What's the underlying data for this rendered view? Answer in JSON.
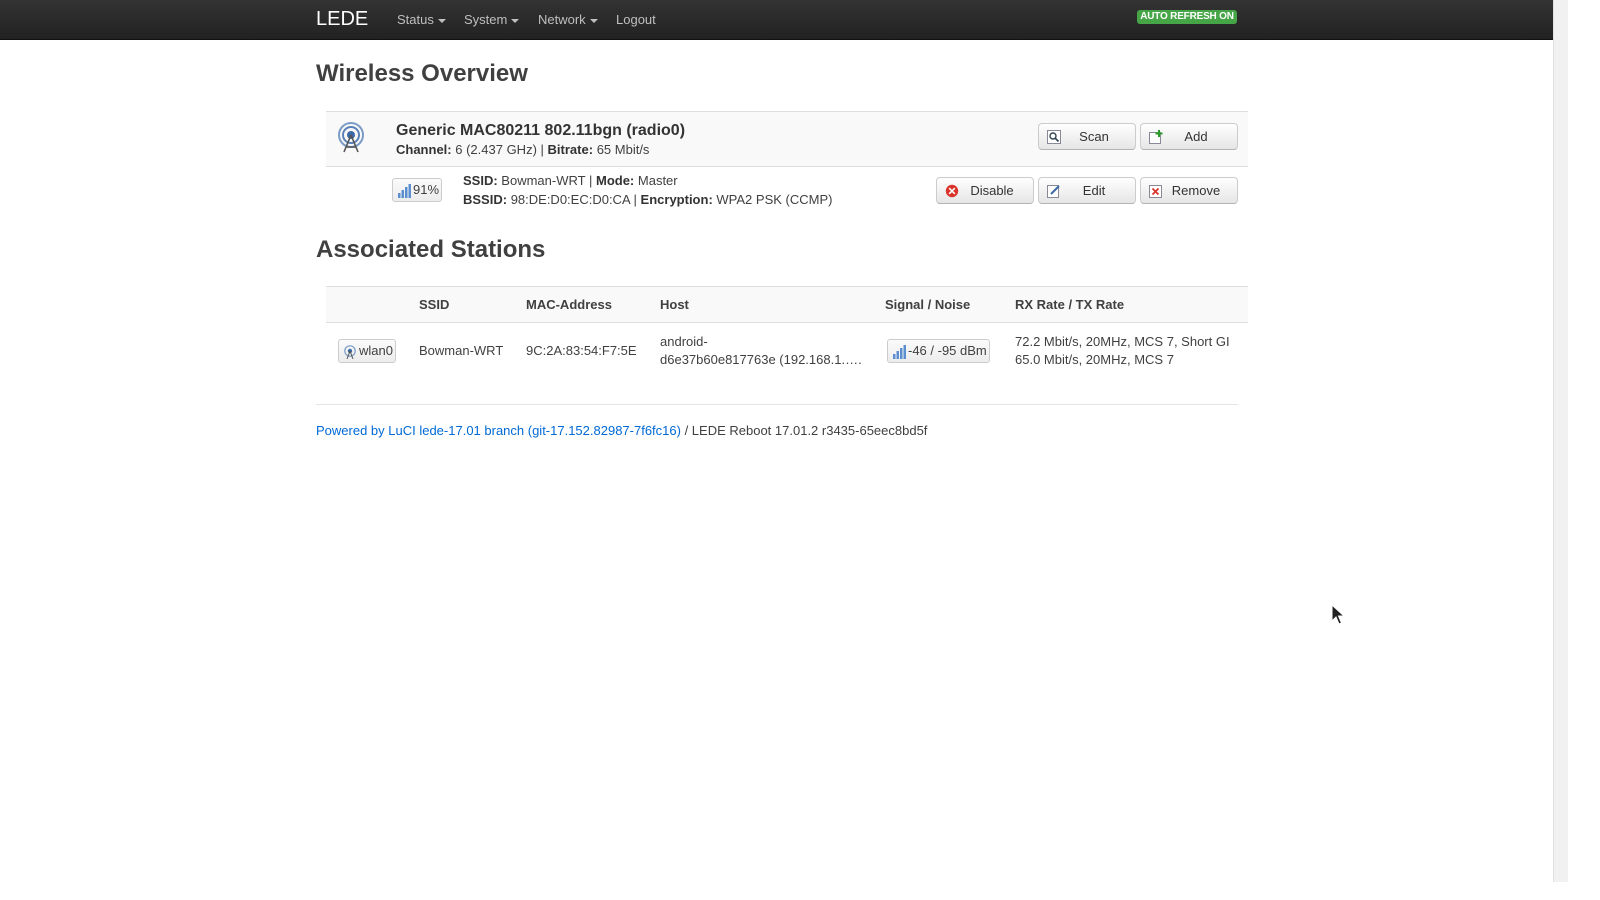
{
  "navbar": {
    "brand": "LEDE",
    "menu": [
      {
        "label": "Status",
        "dropdown": true
      },
      {
        "label": "System",
        "dropdown": true
      },
      {
        "label": "Network",
        "dropdown": true
      },
      {
        "label": "Logout",
        "dropdown": false
      }
    ],
    "auto_refresh": "AUTO REFRESH ON",
    "auto_refresh_color": "#46a546"
  },
  "wireless": {
    "title": "Wireless Overview",
    "radio": {
      "icon": "wifi-radio-icon",
      "name": "Generic MAC80211 802.11bgn (radio0)",
      "channel_label": "Channel:",
      "channel_value": "6 (2.437 GHz)",
      "separator": "|",
      "bitrate_label": "Bitrate:",
      "bitrate_value": "65 Mbit/s",
      "scan_label": "Scan",
      "add_label": "Add"
    },
    "network": {
      "signal_percent": "91%",
      "ssid_label": "SSID:",
      "ssid_value": "Bowman-WRT",
      "separator": "|",
      "mode_label": "Mode:",
      "mode_value": "Master",
      "bssid_label": "BSSID:",
      "bssid_value": "98:DE:D0:EC:D0:CA",
      "encryption_label": "Encryption:",
      "encryption_value": "WPA2 PSK (CCMP)",
      "disable_label": "Disable",
      "edit_label": "Edit",
      "remove_label": "Remove"
    }
  },
  "stations": {
    "title": "Associated Stations",
    "columns": [
      "SSID",
      "MAC-Address",
      "Host",
      "Signal / Noise",
      "RX Rate / TX Rate"
    ],
    "rows": [
      {
        "iface": "wlan0",
        "ssid": "Bowman-WRT",
        "mac": "9C:2A:83:54:F7:5E",
        "host_line1": "android-",
        "host_line2": "d6e37b60e817763e (192.168.1.….",
        "signal_noise": "-46 / -95 dBm",
        "rx_rate": "72.2 Mbit/s, 20MHz, MCS 7, Short GI",
        "tx_rate": "65.0 Mbit/s, 20MHz, MCS 7"
      }
    ]
  },
  "footer": {
    "link_text": "Powered by LuCI lede-17.01 branch (git-17.152.82987-7f6fc16)",
    "rest_text": " / LEDE Reboot 17.01.2 r3435-65eec8bd5f",
    "link_color": "#0069d6"
  }
}
